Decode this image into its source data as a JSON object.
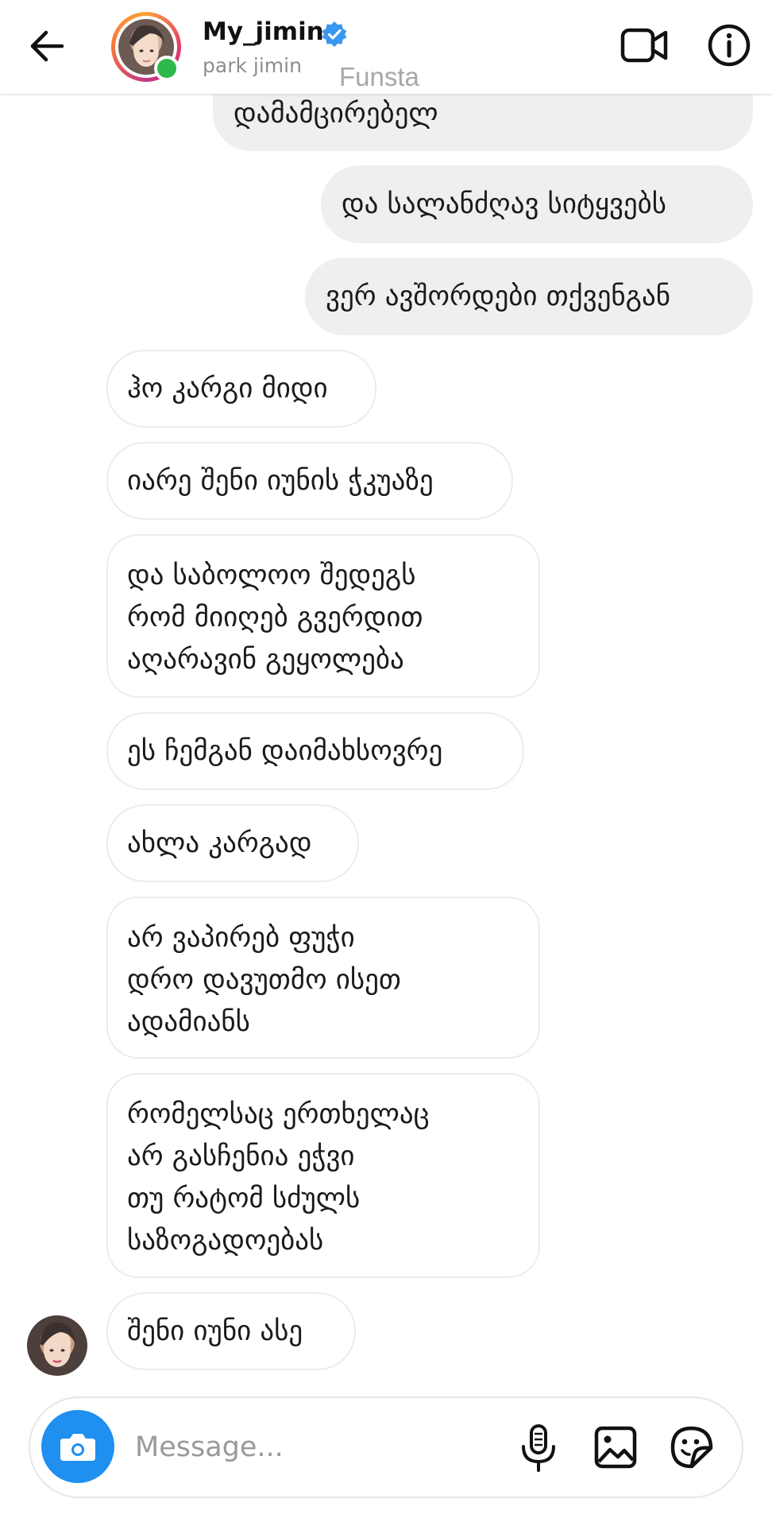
{
  "header": {
    "user_name": "My_jimin",
    "user_subtitle": "park jimin",
    "watermark": "Funsta",
    "icons": [
      "back-arrow-icon",
      "verified-badge-icon",
      "video-call-icon",
      "info-icon"
    ]
  },
  "messages": [
    {
      "from": "me",
      "text": "დამამცირებელ"
    },
    {
      "from": "me",
      "text": "და სალანძღავ სიტყვებს"
    },
    {
      "from": "me",
      "text": "ვერ ავშორდები თქვენგან"
    },
    {
      "from": "them",
      "text": "ჰო კარგი მიდი"
    },
    {
      "from": "them",
      "text": "იარე შენი იუნის ჭკუაზე"
    },
    {
      "from": "them",
      "text": "და საბოლოო შედეგს\nრომ მიიღებ გვერდით\nაღარავინ გეყოლება"
    },
    {
      "from": "them",
      "text": "ეს ჩემგან დაიმახსოვრე"
    },
    {
      "from": "them",
      "text": "ახლა კარგად"
    },
    {
      "from": "them",
      "text": "არ ვაპირებ ფუჭი\nდრო დავუთმო ისეთ\nადამიანს"
    },
    {
      "from": "them",
      "text": "რომელსაც ერთხელაც\nარ გასჩენია ეჭვი\nთუ რატომ სძულს\nსაზოგადოებას"
    },
    {
      "from": "them",
      "text": "შენი იუნი ასე"
    }
  ],
  "composer": {
    "placeholder": "Message...",
    "icons": [
      "camera-icon",
      "microphone-icon",
      "gallery-icon",
      "sticker-icon"
    ]
  },
  "colors": {
    "accent": "#1f8ff0",
    "verified": "#3897f0",
    "online": "#2fb94a",
    "outgoing_bubble": "#efefef"
  }
}
